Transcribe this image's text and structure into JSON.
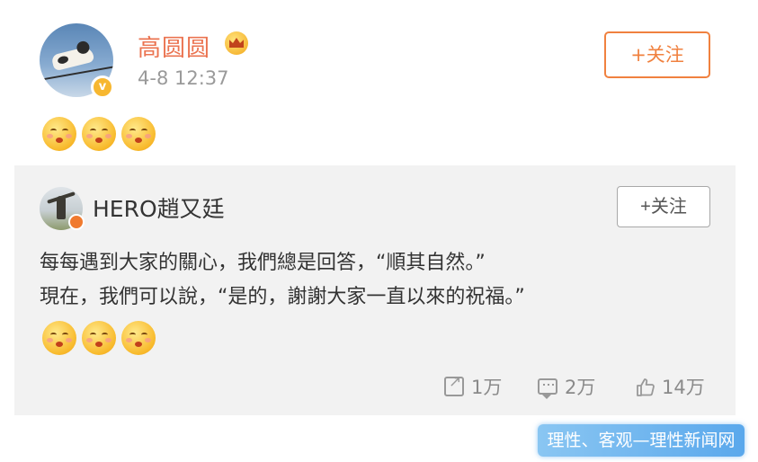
{
  "post": {
    "author": "高圆圆",
    "timestamp": "4-8 12:37",
    "follow_label": "+关注",
    "emoji_count": 3
  },
  "repost": {
    "author": "HERO趙又廷",
    "follow_label": "+关注",
    "text_line1": "每每遇到大家的關心，我們總是回答，“順其自然。”",
    "text_line2": "現在，我們可以說，“是的，謝謝大家一直以來的祝福。”"
  },
  "actions": {
    "repost_count": "1万",
    "comment_count": "2万",
    "like_count": "14万"
  },
  "watermark": "理性、客观—理性新闻网",
  "colors": {
    "accent": "#eb7350",
    "follow_border": "#f0813f",
    "panel_bg": "#f2f2f2",
    "watermark_bg": "#6fb4ee"
  }
}
